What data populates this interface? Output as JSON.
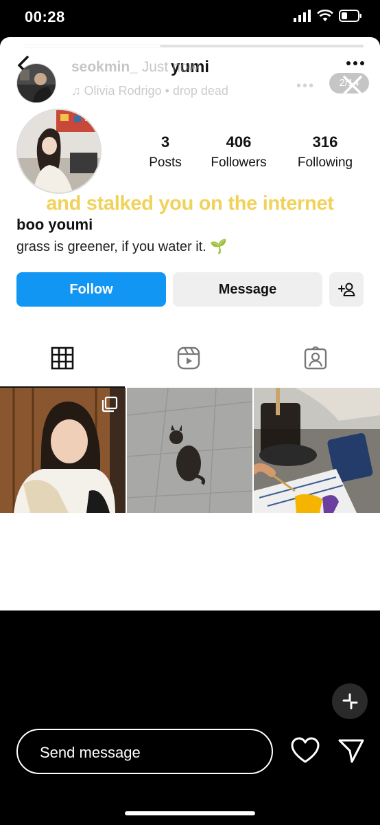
{
  "status_bar": {
    "time": "00:28"
  },
  "story": {
    "progress": 0.4,
    "username": "seokmin_",
    "time_label": "Just now",
    "music": "♫ Olivia Rodrigo • drop dead",
    "counter": "2/14"
  },
  "profile": {
    "username": "yumi",
    "stats": [
      {
        "value": "3",
        "label": "Posts"
      },
      {
        "value": "406",
        "label": "Followers"
      },
      {
        "value": "316",
        "label": "Following"
      }
    ],
    "display_name": "boo youmi",
    "bio": "grass is greener, if you water it. 🌱",
    "follow_label": "Follow",
    "message_label": "Message"
  },
  "caption": "and stalked you on the internet",
  "reply": {
    "placeholder": "Send message"
  },
  "tabs": [
    "grid-icon",
    "reels-icon",
    "tagged-icon"
  ],
  "colors": {
    "follow_blue": "#1296f3",
    "caption_yellow": "#f0d25a"
  }
}
